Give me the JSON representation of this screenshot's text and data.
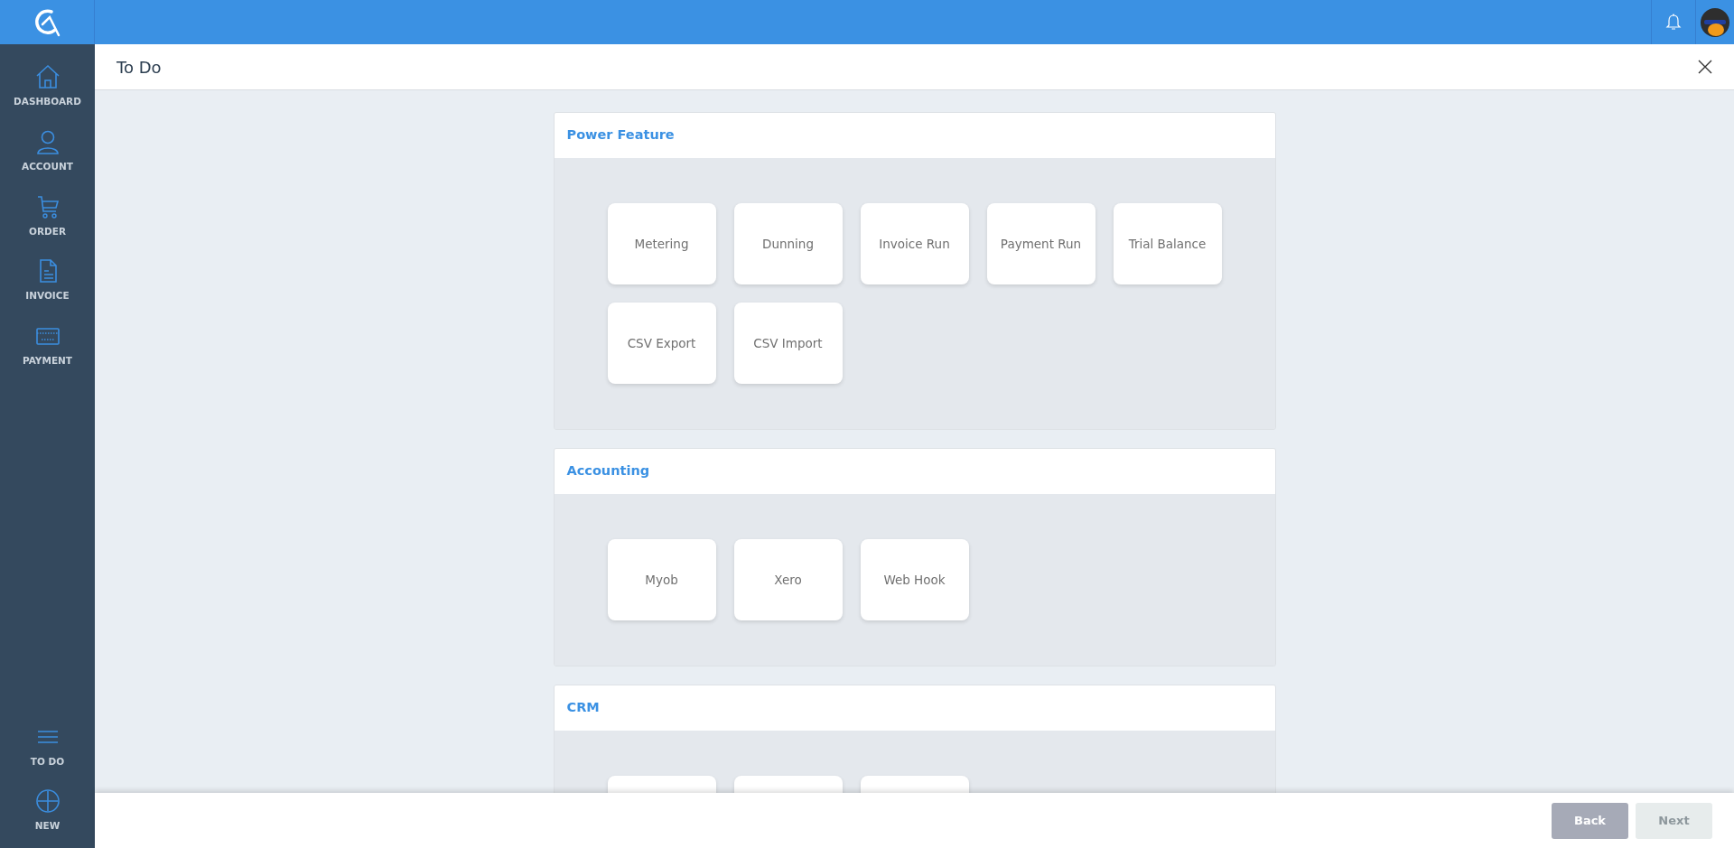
{
  "sidebar": {
    "items": [
      {
        "label": "DASHBOARD",
        "kind": "home"
      },
      {
        "label": "ACCOUNT",
        "kind": "person"
      },
      {
        "label": "ORDER",
        "kind": "cart"
      },
      {
        "label": "INVOICE",
        "kind": "document"
      },
      {
        "label": "PAYMENT",
        "kind": "card"
      }
    ],
    "bottom_items": [
      {
        "label": "TO DO",
        "kind": "menu"
      },
      {
        "label": "NEW",
        "kind": "plus"
      }
    ]
  },
  "page": {
    "title": "To Do"
  },
  "sections": [
    {
      "title": "Power Feature",
      "tiles": [
        {
          "kind": "feature",
          "label": "Metering"
        },
        {
          "kind": "feature",
          "label": "Dunning"
        },
        {
          "kind": "feature",
          "label": "Invoice Run"
        },
        {
          "kind": "feature",
          "label": "Payment Run"
        },
        {
          "kind": "feature",
          "label": "Trial Balance"
        },
        {
          "kind": "feature",
          "label": "CSV Export"
        },
        {
          "kind": "feature",
          "label": "CSV Import"
        }
      ]
    },
    {
      "title": "Accounting",
      "tiles": [
        {
          "kind": "feature",
          "label": "Myob"
        },
        {
          "kind": "feature",
          "label": "Xero"
        },
        {
          "kind": "feature",
          "label": "Web Hook"
        }
      ]
    },
    {
      "title": "CRM",
      "tiles": [
        {
          "kind": "blank"
        },
        {
          "kind": "blank"
        },
        {
          "kind": "blank"
        }
      ]
    }
  ],
  "footer": {
    "buttons": [
      {
        "label": "Back",
        "disabled": false
      },
      {
        "label": "Next",
        "disabled": true
      }
    ]
  }
}
